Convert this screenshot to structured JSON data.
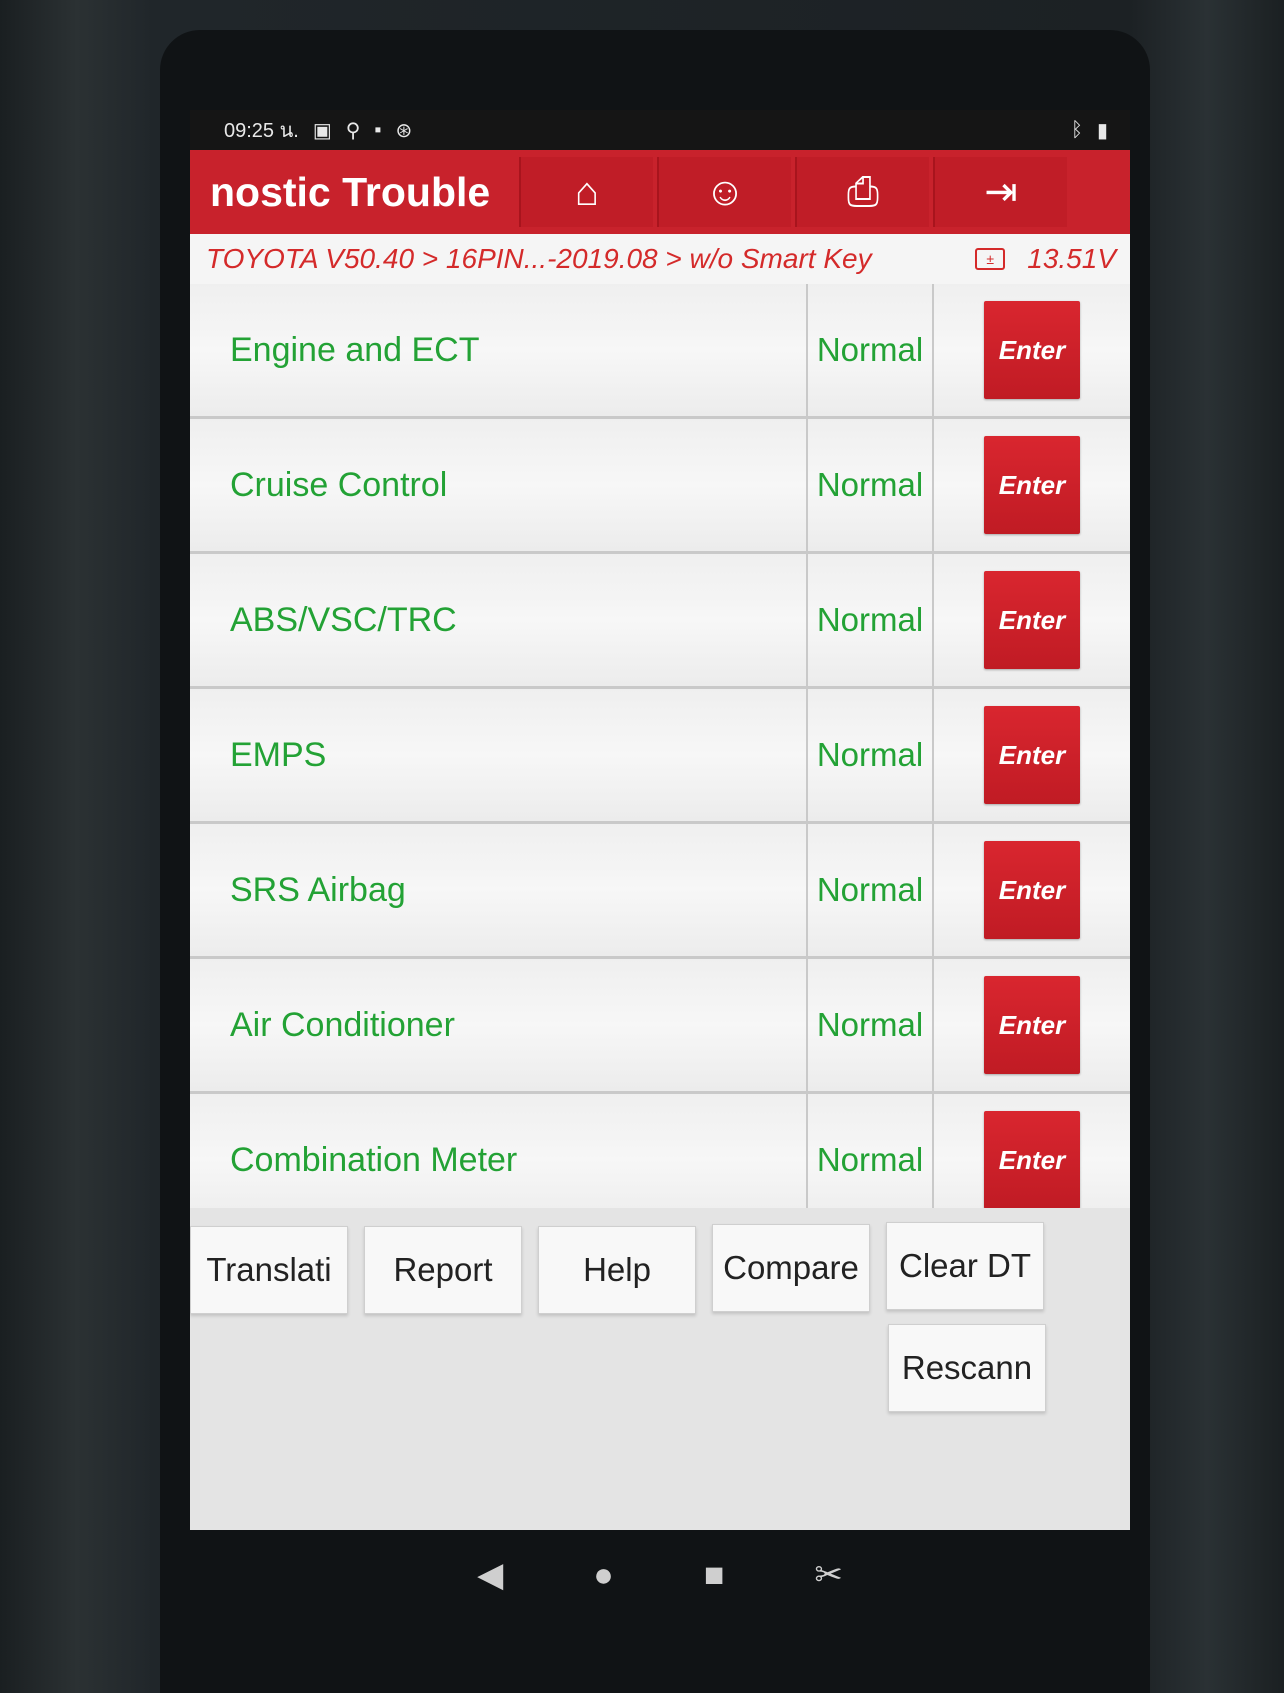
{
  "status_bar": {
    "time": "09:25 น.",
    "left_icons": [
      "sim-icon",
      "usb-icon",
      "image-icon",
      "bluetooth-scan-icon"
    ],
    "right_icons": [
      "bluetooth-icon",
      "battery-icon"
    ]
  },
  "header": {
    "title": "nostic Trouble",
    "nav_buttons": [
      {
        "icon": "home-icon",
        "glyph": "⌂"
      },
      {
        "icon": "support-icon",
        "glyph": "☺"
      },
      {
        "icon": "print-icon",
        "glyph": "⎙"
      },
      {
        "icon": "exit-icon",
        "glyph": "⇥"
      }
    ]
  },
  "breadcrumb": {
    "path": "TOYOTA V50.40 > 16PIN...-2019.08 > w/o Smart Key",
    "battery_icon": "±",
    "voltage": "13.51V"
  },
  "systems": [
    {
      "name": "Engine and ECT",
      "status": "Normal",
      "action": "Enter"
    },
    {
      "name": "Cruise Control",
      "status": "Normal",
      "action": "Enter"
    },
    {
      "name": "ABS/VSC/TRC",
      "status": "Normal",
      "action": "Enter"
    },
    {
      "name": "EMPS",
      "status": "Normal",
      "action": "Enter"
    },
    {
      "name": "SRS Airbag",
      "status": "Normal",
      "action": "Enter"
    },
    {
      "name": "Air Conditioner",
      "status": "Normal",
      "action": "Enter"
    },
    {
      "name": "Combination Meter",
      "status": "Normal",
      "action": "Enter"
    }
  ],
  "toolbar": {
    "translation": "Translati",
    "report": "Report",
    "help": "Help",
    "compare": "Compare",
    "clear_dtc": "Clear DT",
    "rescan": "Rescann"
  },
  "nav_bar": {
    "back": "◀",
    "home": "●",
    "recents": "■",
    "screenshot": "✂"
  },
  "colors": {
    "accent_red": "#c8222c",
    "status_green": "#23a235"
  }
}
